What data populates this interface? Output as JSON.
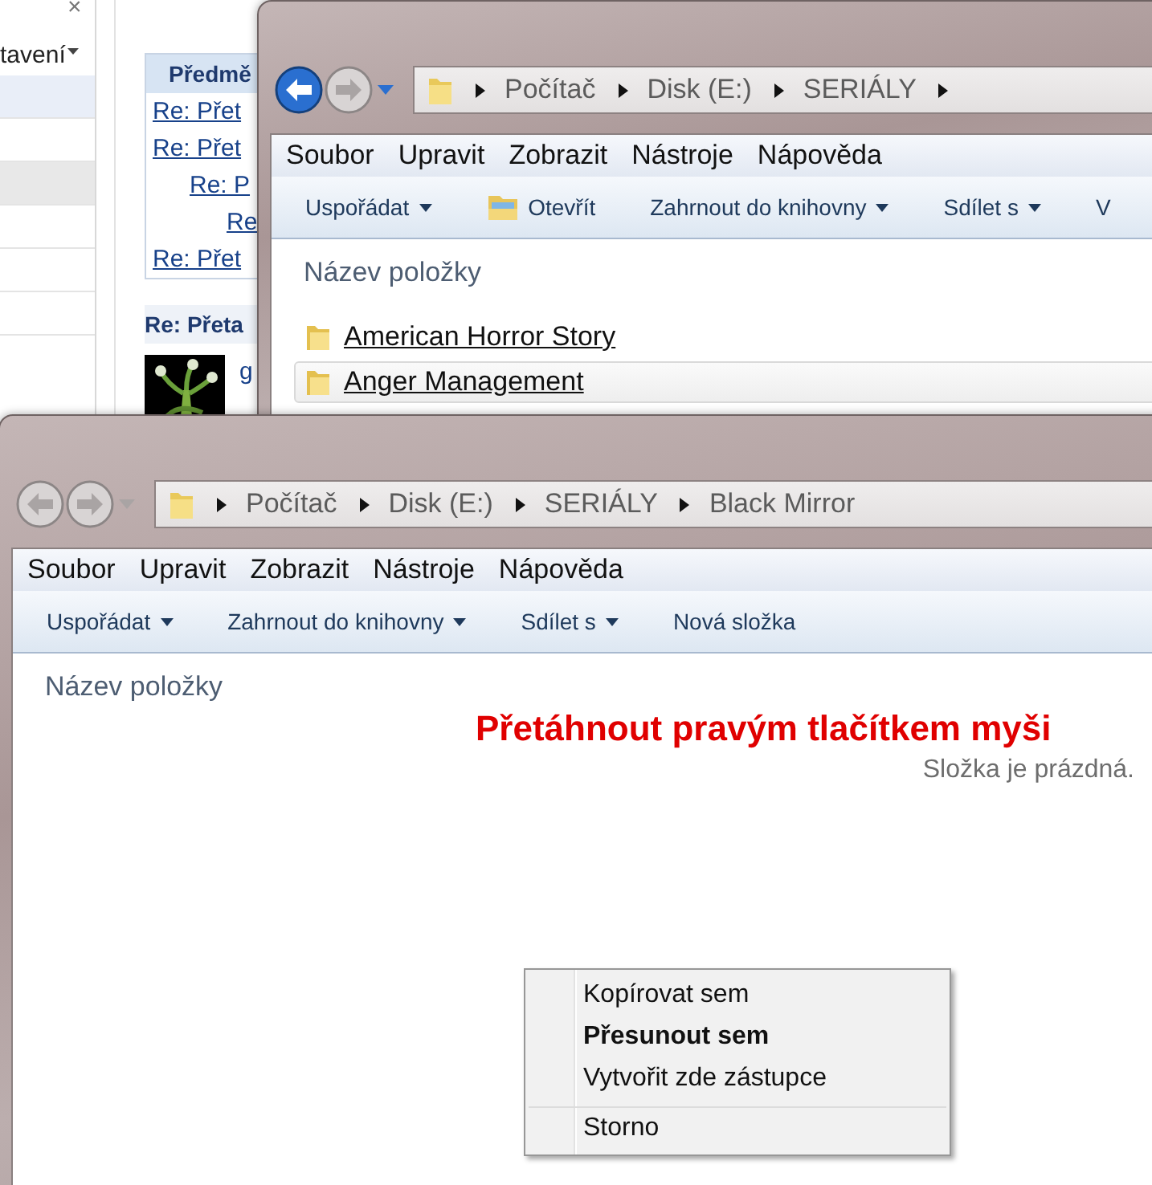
{
  "background_page": {
    "close_glyph": "×",
    "settings_label": "tavení",
    "table_header": "Předmě",
    "threads": [
      {
        "text": "Re: Přet"
      },
      {
        "text": "Re: Přet",
        "children": [
          {
            "text": "Re: P",
            "children": [
              {
                "text": "Re"
              }
            ]
          }
        ]
      },
      {
        "text": "Re: Přet"
      }
    ],
    "post_title": "Re: Přeta",
    "author_link": "g"
  },
  "windows": [
    {
      "back_enabled": true,
      "breadcrumb": [
        "Počítač",
        "Disk (E:)",
        "SERIÁLY"
      ],
      "trailing_arrow": true,
      "menu": [
        "Soubor",
        "Upravit",
        "Zobrazit",
        "Nástroje",
        "Nápověda"
      ],
      "toolbar": [
        {
          "label": "Uspořádat",
          "kind": "dropdown"
        },
        {
          "label": "Otevřít",
          "kind": "open"
        },
        {
          "label": "Zahrnout do knihovny",
          "kind": "dropdown"
        },
        {
          "label": "Sdílet s",
          "kind": "dropdown"
        },
        {
          "label": "V",
          "kind": "plain"
        }
      ],
      "column_header": "Název položky",
      "items": [
        {
          "name": "American Horror Story",
          "selected": false
        },
        {
          "name": "Anger Management",
          "selected": true
        }
      ]
    },
    {
      "back_enabled": false,
      "breadcrumb": [
        "Počítač",
        "Disk (E:)",
        "SERIÁLY",
        "Black Mirror"
      ],
      "trailing_arrow": false,
      "menu": [
        "Soubor",
        "Upravit",
        "Zobrazit",
        "Nástroje",
        "Nápověda"
      ],
      "toolbar": [
        {
          "label": "Uspořádat",
          "kind": "dropdown"
        },
        {
          "label": "Zahrnout do knihovny",
          "kind": "dropdown"
        },
        {
          "label": "Sdílet s",
          "kind": "dropdown"
        },
        {
          "label": "Nová složka",
          "kind": "plain"
        }
      ],
      "column_header": "Název položky",
      "empty_text": "Složka je prázdná."
    }
  ],
  "annotation": "Přetáhnout pravým tlačítkem myši",
  "context_menu": [
    {
      "label": "Kopírovat sem",
      "default": false,
      "separator_before": false
    },
    {
      "label": "Přesunout sem",
      "default": true,
      "separator_before": false
    },
    {
      "label": "Vytvořit zde zástupce",
      "default": false,
      "separator_before": false
    },
    {
      "label": "Storno",
      "default": false,
      "separator_before": true
    }
  ]
}
